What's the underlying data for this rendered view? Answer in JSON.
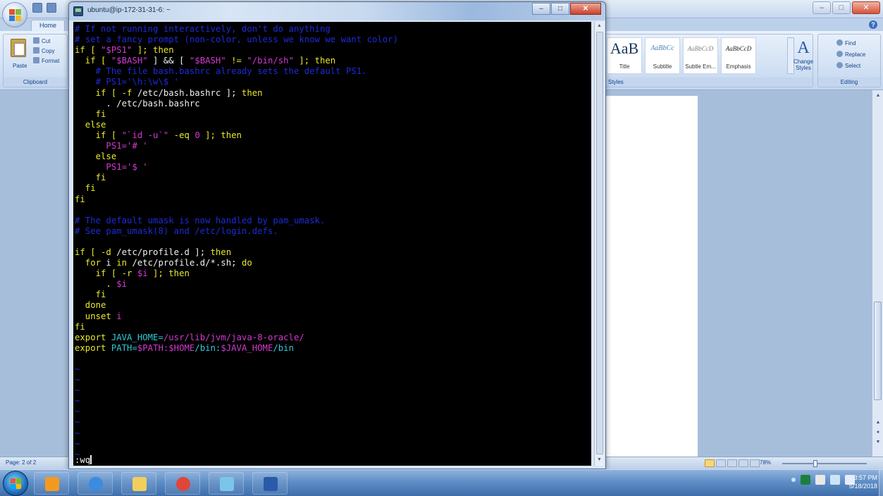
{
  "word": {
    "tab_home": "Home",
    "clipboard": {
      "paste_label": "Paste",
      "cut_label": "Cut",
      "copy_label": "Copy",
      "format_painter_label": "Format",
      "group_label": "Clipboard"
    },
    "styles": {
      "tiles": [
        {
          "sample": "AaB",
          "name": "Title"
        },
        {
          "sample": "AaBbCc",
          "name": "Subtitle"
        },
        {
          "sample": "AaBbCcD",
          "name": "Subtle Em..."
        },
        {
          "sample": "AaBbCcD",
          "name": "Emphasis"
        }
      ],
      "change_styles_glyph": "A",
      "change_styles_label": "Change Styles",
      "group_label": "Styles"
    },
    "editing": {
      "find_label": "Find",
      "replace_label": "Replace",
      "select_label": "Select",
      "group_label": "Editing"
    },
    "status": {
      "page_count": "Page: 2 of 2",
      "zoom_level": "78%"
    },
    "help_glyph": "?"
  },
  "putty": {
    "title": "ubuntu@ip-172-31-31-6: ~",
    "minimize_glyph": "–",
    "maximize_glyph": "□",
    "close_glyph": "✕",
    "command_line": ":wq"
  },
  "terminal_lines": [
    [
      {
        "t": "# If not running interactively, don't do anything",
        "c": "#1d2bd6"
      }
    ],
    [
      {
        "t": "# set a fancy prompt (non-color, unless we know we want color)",
        "c": "#1d2bd6"
      }
    ],
    [
      {
        "t": "if [ ",
        "c": "#e8e82a"
      },
      {
        "t": "\"$PS1\"",
        "c": "#d23ad2"
      },
      {
        "t": " ]; then",
        "c": "#e8e82a"
      }
    ],
    [
      {
        "t": "  if [ ",
        "c": "#e8e82a"
      },
      {
        "t": "\"$BASH\"",
        "c": "#d23ad2"
      },
      {
        "t": " ] && [ ",
        "c": "#f0f0f0"
      },
      {
        "t": "\"$BASH\"",
        "c": "#d23ad2"
      },
      {
        "t": " != ",
        "c": "#e8e82a"
      },
      {
        "t": "\"/bin/sh\"",
        "c": "#d23ad2"
      },
      {
        "t": " ]; then",
        "c": "#e8e82a"
      }
    ],
    [
      {
        "t": "    # The file bash.bashrc already sets the default PS1.",
        "c": "#1d2bd6"
      }
    ],
    [
      {
        "t": "    # PS1='\\h:\\w\\$ '",
        "c": "#1d2bd6"
      }
    ],
    [
      {
        "t": "    if [ -f ",
        "c": "#e8e82a"
      },
      {
        "t": "/etc/bash.bashrc ]; ",
        "c": "#f0f0f0"
      },
      {
        "t": "then",
        "c": "#e8e82a"
      }
    ],
    [
      {
        "t": "      . /etc/bash.bashrc",
        "c": "#f0f0f0"
      }
    ],
    [
      {
        "t": "    fi",
        "c": "#e8e82a"
      }
    ],
    [
      {
        "t": "  else",
        "c": "#e8e82a"
      }
    ],
    [
      {
        "t": "    if [ ",
        "c": "#e8e82a"
      },
      {
        "t": "\"`id -u`\"",
        "c": "#d23ad2"
      },
      {
        "t": " -eq ",
        "c": "#e8e82a"
      },
      {
        "t": "0",
        "c": "#d23ad2"
      },
      {
        "t": " ]; then",
        "c": "#e8e82a"
      }
    ],
    [
      {
        "t": "      PS1=",
        "c": "#d23ad2"
      },
      {
        "t": "'# '",
        "c": "#d23ad2"
      }
    ],
    [
      {
        "t": "    else",
        "c": "#e8e82a"
      }
    ],
    [
      {
        "t": "      PS1=",
        "c": "#d23ad2"
      },
      {
        "t": "'$ '",
        "c": "#d23ad2"
      }
    ],
    [
      {
        "t": "    fi",
        "c": "#e8e82a"
      }
    ],
    [
      {
        "t": "  fi",
        "c": "#e8e82a"
      }
    ],
    [
      {
        "t": "fi",
        "c": "#e8e82a"
      }
    ],
    [
      {
        "t": "",
        "c": "#f0f0f0"
      }
    ],
    [
      {
        "t": "# The default umask is now handled by pam_umask.",
        "c": "#1d2bd6"
      }
    ],
    [
      {
        "t": "# See pam_umask(8) and /etc/login.defs.",
        "c": "#1d2bd6"
      }
    ],
    [
      {
        "t": "",
        "c": "#f0f0f0"
      }
    ],
    [
      {
        "t": "if [ -d ",
        "c": "#e8e82a"
      },
      {
        "t": "/etc/profile.d ]; ",
        "c": "#f0f0f0"
      },
      {
        "t": "then",
        "c": "#e8e82a"
      }
    ],
    [
      {
        "t": "  for ",
        "c": "#e8e82a"
      },
      {
        "t": "i ",
        "c": "#f0f0f0"
      },
      {
        "t": "in ",
        "c": "#e8e82a"
      },
      {
        "t": "/etc/profile.d/*.sh; ",
        "c": "#f0f0f0"
      },
      {
        "t": "do",
        "c": "#e8e82a"
      }
    ],
    [
      {
        "t": "    if [ -r ",
        "c": "#e8e82a"
      },
      {
        "t": "$i",
        "c": "#d23ad2"
      },
      {
        "t": " ]; then",
        "c": "#e8e82a"
      }
    ],
    [
      {
        "t": "      . ",
        "c": "#e8e82a"
      },
      {
        "t": "$i",
        "c": "#d23ad2"
      }
    ],
    [
      {
        "t": "    fi",
        "c": "#e8e82a"
      }
    ],
    [
      {
        "t": "  done",
        "c": "#e8e82a"
      }
    ],
    [
      {
        "t": "  unset ",
        "c": "#e8e82a"
      },
      {
        "t": "i",
        "c": "#d23ad2"
      }
    ],
    [
      {
        "t": "fi",
        "c": "#e8e82a"
      }
    ],
    [
      {
        "t": "export ",
        "c": "#e8e82a"
      },
      {
        "t": "JAVA_HOME=",
        "c": "#30c8d8"
      },
      {
        "t": "/usr/lib/jvm/java-8-oracle/",
        "c": "#d23ad2"
      }
    ],
    [
      {
        "t": "export ",
        "c": "#e8e82a"
      },
      {
        "t": "PATH=",
        "c": "#30c8d8"
      },
      {
        "t": "$PATH:$HOME",
        "c": "#d23ad2"
      },
      {
        "t": "/bin:",
        "c": "#30c8d8"
      },
      {
        "t": "$JAVA_HOME",
        "c": "#d23ad2"
      },
      {
        "t": "/bin",
        "c": "#30c8d8"
      }
    ],
    [
      {
        "t": "",
        "c": "#f0f0f0"
      }
    ],
    [
      {
        "t": "~",
        "c": "#1d2bd6"
      }
    ],
    [
      {
        "t": "~",
        "c": "#1d2bd6"
      }
    ],
    [
      {
        "t": "~",
        "c": "#1d2bd6"
      }
    ],
    [
      {
        "t": "~",
        "c": "#1d2bd6"
      }
    ],
    [
      {
        "t": "~",
        "c": "#1d2bd6"
      }
    ],
    [
      {
        "t": "~",
        "c": "#1d2bd6"
      }
    ],
    [
      {
        "t": "~",
        "c": "#1d2bd6"
      }
    ],
    [
      {
        "t": "~",
        "c": "#1d2bd6"
      }
    ],
    [
      {
        "t": "~",
        "c": "#1d2bd6"
      }
    ]
  ],
  "taskbar": {
    "apps": [
      {
        "icon": "windows-media-player-icon",
        "color": "#f39a1e"
      },
      {
        "icon": "internet-explorer-icon",
        "color": "#3b8be0"
      },
      {
        "icon": "windows-explorer-icon",
        "color": "#f2cf5a"
      },
      {
        "icon": "chrome-icon",
        "color": "#e0453a"
      },
      {
        "icon": "paint-icon",
        "color": "#7ac6ea"
      },
      {
        "icon": "word-icon",
        "color": "#2a5aa8"
      }
    ],
    "clock_time": "3:57 PM",
    "clock_date": "5/18/2018"
  },
  "colors": {
    "terminal_bg": "#000000",
    "keyword": "#e8e82a",
    "string": "#d23ad2",
    "comment": "#1d2bd6",
    "variable": "#30c8d8"
  }
}
